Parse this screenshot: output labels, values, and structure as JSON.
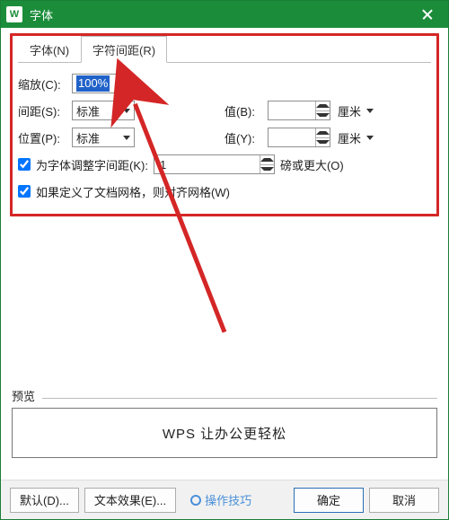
{
  "window": {
    "title": "字体"
  },
  "tabs": {
    "font": "字体(N)",
    "spacing": "字符间距(R)"
  },
  "labels": {
    "scale": "缩放(C):",
    "spacing": "间距(S):",
    "position": "位置(P):",
    "valueB": "值(B):",
    "valueY": "值(Y):",
    "kerning_chk": "为字体调整字间距(K):",
    "kerning_unit": "磅或更大(O)",
    "snap_chk": "如果定义了文档网格，则对齐网格(W)"
  },
  "values": {
    "scale": "100%",
    "spacing": "标准",
    "position": "标准",
    "valueB": "",
    "valueY": "",
    "kerning": "1",
    "unitB": "厘米",
    "unitY": "厘米"
  },
  "preview": {
    "label": "预览",
    "text": "WPS 让办公更轻松"
  },
  "buttons": {
    "default": "默认(D)...",
    "effects": "文本效果(E)...",
    "tips": "操作技巧",
    "ok": "确定",
    "cancel": "取消"
  }
}
